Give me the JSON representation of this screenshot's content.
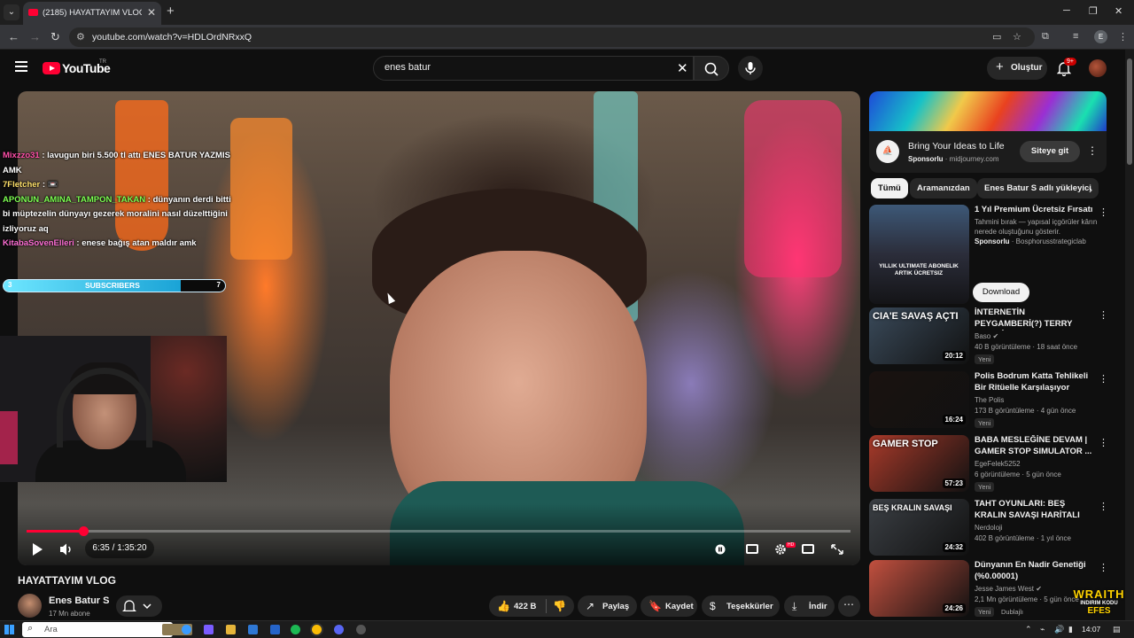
{
  "browser": {
    "tab_title": "(2185) HAYATTAYIM VLOG - YouTube",
    "url": "youtube.com/watch?v=HDLOrdNRxxQ",
    "profile_initial": "E"
  },
  "masthead": {
    "logo_text": "YouTube",
    "region": "TR",
    "search_value": "enes batur",
    "create_label": "Oluştur",
    "notification_count": "9+"
  },
  "player": {
    "chat": [
      {
        "user": "Mixzzo31",
        "text": " : lavugun biri 5.500 tl attı ENES BATUR YAZMIS AMK"
      },
      {
        "user": "7Fletcher",
        "text": " : 📼"
      },
      {
        "user": "APONUN_AMINA_TAMPON_TAKAN",
        "text": " : dünyanın derdi bitti bi müptezelin dünyayı gezerek moralini nasıl düzelttiğini izliyoruz aq"
      },
      {
        "user": "KitabaSovenElleri",
        "text": " : enese bağış atan maldır amk"
      }
    ],
    "subs_bar": {
      "left": "3",
      "label": "SUBSCRIBERS",
      "right": "7"
    },
    "time": "6:35 / 1:35:20",
    "progress": 0.069,
    "hd_badge": "HD"
  },
  "video": {
    "title": "HAYATTAYIM VLOG",
    "channel": "Enes Batur S",
    "subscribers": "17 Mn abone",
    "likes": "422 B",
    "share": "Paylaş",
    "save": "Kaydet",
    "thanks": "Teşekkürler",
    "download": "İndir"
  },
  "sidebar": {
    "ad": {
      "logo": "⛵",
      "title": "Bring Your Ideas to Life",
      "sponsor_label": "Sponsorlu",
      "sponsor_domain": " · midjourney.com",
      "cta": "Siteye git"
    },
    "chips": [
      "Tümü",
      "Aramanızdan",
      "Enes Batur S adlı yükleyici"
    ],
    "sponsored_video": {
      "title": "1 Yıl Premium Ücretsiz Fırsatı",
      "description": "Tahmini bırak — yapısal içgörüler kârın nerede oluştuğunu gösterir.",
      "sponsor_label": "Sponsorlu",
      "sponsor_name": " · Bosphorusstrategiclab",
      "thumb_text": "YILLIK ULTIMATE ABONELIK ARTIK ÜCRETSIZ",
      "cta": "Download"
    },
    "recommendations": [
      {
        "title": "İNTERNETİN PEYGAMBERİ(?) TERRY DAVIS'İN GERÇEK ...",
        "channel": "Baso ✔",
        "meta": "40 B görüntüleme · 18 saat önce",
        "badge": "Yeni",
        "duration": "20:12",
        "thumb_text": "CIA'E SAVAŞ AÇTI",
        "thumb_color": "#3a4a5a"
      },
      {
        "title": "Polis Bodrum Katta Tehlikeli Bir Ritüelle Karşılaşıyor",
        "channel": "The Polis",
        "meta": "173 B görüntüleme · 4 gün önce",
        "badge": "Yeni",
        "duration": "16:24",
        "thumb_text": "",
        "thumb_color": "#1a1210"
      },
      {
        "title": "BABA MESLEĞİNE DEVAM | GAMER STOP SIMULATOR ...",
        "channel": "EgeFelek5252",
        "meta": "6 görüntüleme · 5 gün önce",
        "badge": "Yeni",
        "duration": "57:23",
        "thumb_text": "GAMER STOP",
        "thumb_color": "#a83a2a"
      },
      {
        "title": "TAHT OYUNLARI: BEŞ KRALIN SAVAŞI HARİTALI ANLATIM ...",
        "channel": "Nerdoloji",
        "meta": "402 B görüntüleme · 1 yıl önce",
        "badge": "",
        "duration": "24:32",
        "thumb_text": "BEŞ KRALIN SAVAŞI",
        "thumb_color": "#3b3f44"
      },
      {
        "title": "Dünyanın En Nadir Genetiği (%0.00001)",
        "channel": "Jesse James West ✔",
        "meta": "2,1 Mn görüntüleme · 5 gün önce",
        "badge": "Yeni",
        "duration": "24:26",
        "thumb_text": "",
        "thumb_color": "#c2503f"
      }
    ],
    "dub_label": "Dublajlı"
  },
  "overlay_ad": {
    "brand": "WRAITH",
    "line2": "INDIRIM KODU",
    "line3": "EFES"
  },
  "taskbar": {
    "search_placeholder": "Ara",
    "time": "14:07"
  }
}
